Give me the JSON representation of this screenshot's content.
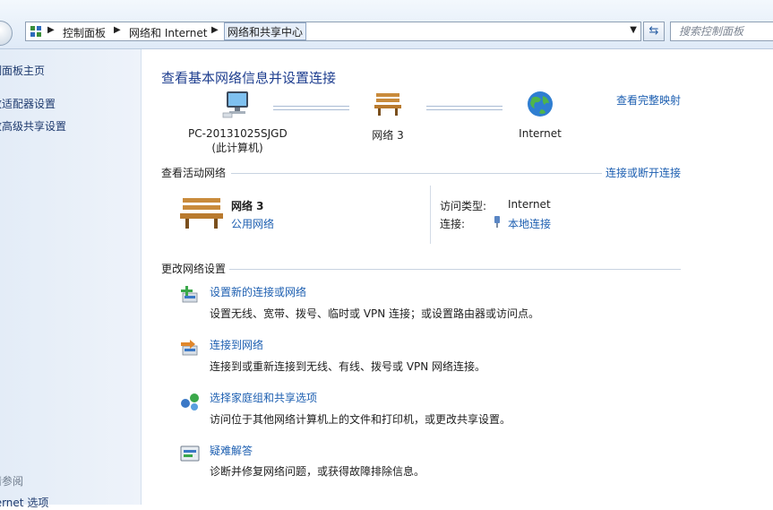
{
  "address_bar": {
    "breadcrumbs": [
      "控制面板",
      "网络和 Internet",
      "网络和共享中心"
    ],
    "search_placeholder": "搜索控制面板"
  },
  "nav_pane": {
    "links": [
      "制面板主页",
      "改适配器设置",
      "改高级共享设置"
    ],
    "see_also_heading": "请参阅",
    "see_also_links": [
      "ternet 选项"
    ]
  },
  "main": {
    "title": "查看基本网络信息并设置连接",
    "full_map_link": "查看完整映射",
    "network_map": {
      "computer_name": "PC-20131025SJGD",
      "computer_sub": "(此计算机)",
      "network": "网络  3",
      "internet": "Internet"
    },
    "active_networks": {
      "heading": "查看活动网络",
      "connect_link": "连接或断开连接",
      "network_name": "网络  3",
      "network_type": "公用网络",
      "access_type_label": "访问类型:",
      "access_type_value": "Internet",
      "connection_label": "连接:",
      "connection_value": "本地连接"
    },
    "change_settings": {
      "heading": "更改网络设置",
      "tasks": [
        {
          "title": "设置新的连接或网络",
          "desc": "设置无线、宽带、拨号、临时或 VPN 连接；或设置路由器或访问点。"
        },
        {
          "title": "连接到网络",
          "desc": "连接到或重新连接到无线、有线、拨号或 VPN 网络连接。"
        },
        {
          "title": "选择家庭组和共享选项",
          "desc": "访问位于其他网络计算机上的文件和打印机，或更改共享设置。"
        },
        {
          "title": "疑难解答",
          "desc": "诊断并修复网络问题，或获得故障排除信息。"
        }
      ]
    }
  },
  "colors": {
    "link": "#1d5fb1",
    "title": "#1e3e8f",
    "nav_background": "#e3ecf7"
  }
}
